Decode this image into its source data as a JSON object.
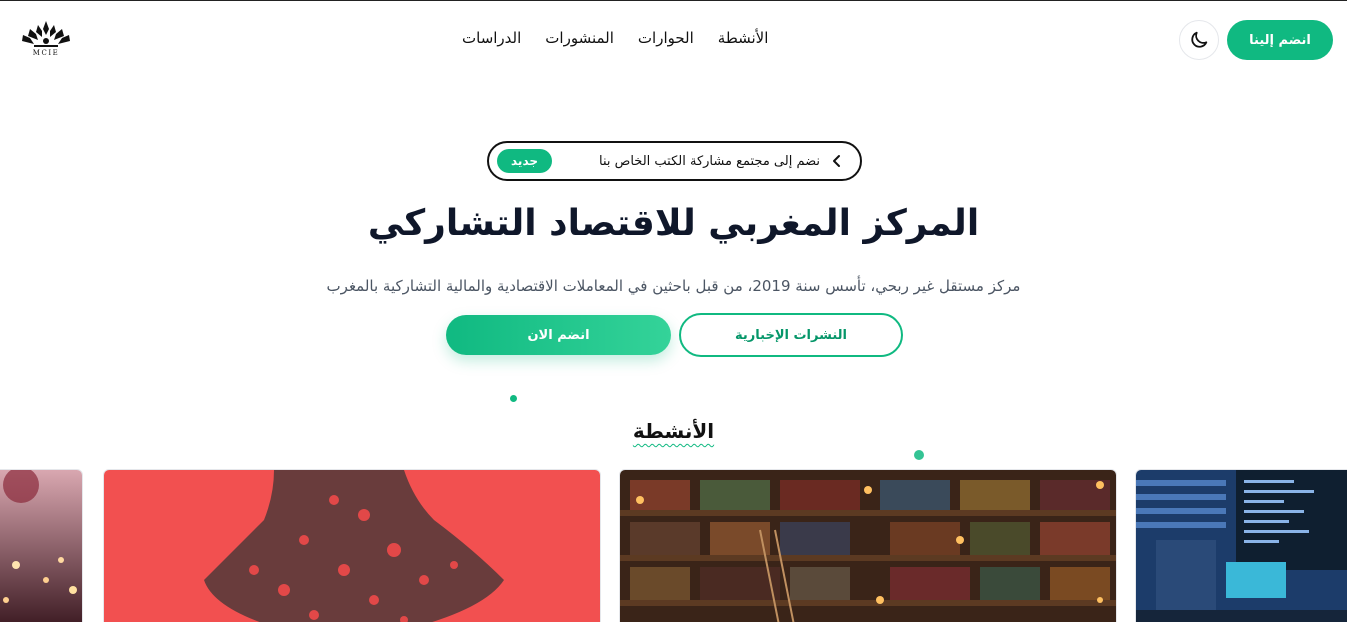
{
  "logo": {
    "text": "MCIE"
  },
  "nav": {
    "links": [
      "الدراسات",
      "المنشورات",
      "الحوارات",
      "الأنشطة"
    ],
    "join_label": "انضم إلينا"
  },
  "announcement": {
    "text": "نضم إلى مجتمع مشاركة الكتب الخاص بنا",
    "badge": "جديد"
  },
  "hero": {
    "title": "المركز المغربي للاقتصاد التشاركي",
    "subtitle": "مركز مستقل غير ربحي، تأسس سنة 2019، من قبل باحثين في المعاملات الاقتصادية والمالية التشاركية بالمغرب",
    "primary_label": "انضم الان",
    "secondary_label": "النشرات الإخبارية"
  },
  "activities": {
    "title": "الأنشطة"
  },
  "colors": {
    "accent": "#10b981",
    "text": "#0f172a",
    "muted": "#4b5563"
  },
  "icons": [
    "moon-icon",
    "chevron-left-icon",
    "lotus-logo-icon"
  ]
}
